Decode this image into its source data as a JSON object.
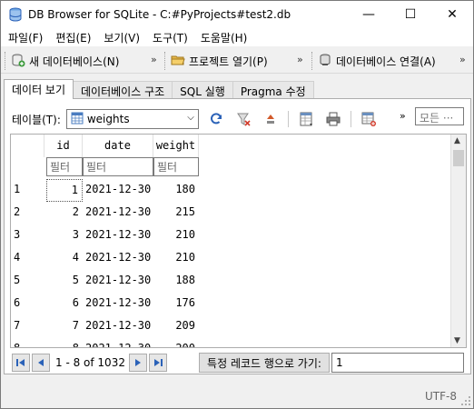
{
  "window": {
    "title": "DB Browser for SQLite - C:#PyProjects#test2.db",
    "minimize_glyph": "—",
    "maximize_glyph": "☐",
    "close_glyph": "✕"
  },
  "menu": [
    "파일(F)",
    "편집(E)",
    "보기(V)",
    "도구(T)",
    "도움말(H)"
  ],
  "toolbar": {
    "new_db": "새 데이터베이스(N)",
    "open_project": "프로젝트 열기(P)",
    "attach_db": "데이터베이스 연결(A)",
    "more": "»"
  },
  "tabs": [
    "데이터 보기",
    "데이터베이스 구조",
    "SQL 실행",
    "Pragma 수정"
  ],
  "browse": {
    "table_label": "테이블(T):",
    "table_value": "weights",
    "filter_placeholder": "모든 ···",
    "more": "»"
  },
  "grid": {
    "columns": [
      "id",
      "date",
      "weight"
    ],
    "filter_placeholder": "필터",
    "rows": [
      {
        "row": "1",
        "id": "1",
        "date": "2021-12-30",
        "weight": "180"
      },
      {
        "row": "2",
        "id": "2",
        "date": "2021-12-30",
        "weight": "215"
      },
      {
        "row": "3",
        "id": "3",
        "date": "2021-12-30",
        "weight": "210"
      },
      {
        "row": "4",
        "id": "4",
        "date": "2021-12-30",
        "weight": "210"
      },
      {
        "row": "5",
        "id": "5",
        "date": "2021-12-30",
        "weight": "188"
      },
      {
        "row": "6",
        "id": "6",
        "date": "2021-12-30",
        "weight": "176"
      },
      {
        "row": "7",
        "id": "7",
        "date": "2021-12-30",
        "weight": "209"
      },
      {
        "row": "8",
        "id": "8",
        "date": "2021-12-30",
        "weight": "200"
      }
    ]
  },
  "nav": {
    "page_info": "1 - 8 of 1032",
    "goto_label": "특정 레코드 행으로 가기:",
    "goto_value": "1"
  },
  "status": {
    "encoding": "UTF-8"
  },
  "colors": {
    "accent_blue": "#2b62b8",
    "window_bg": "#f0f0f0"
  }
}
